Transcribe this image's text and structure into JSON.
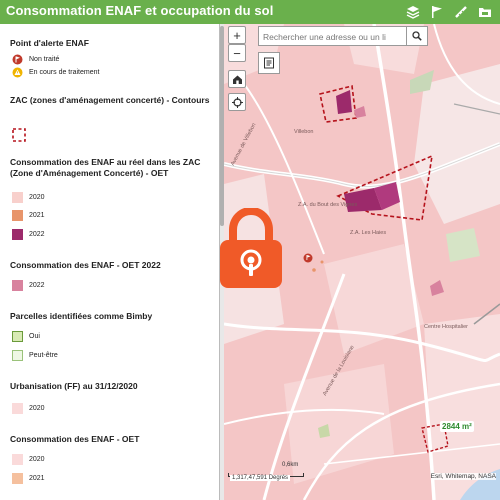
{
  "header": {
    "title": "Consommation ENAF et occupation du sol",
    "background": "#6ab04c",
    "tools": [
      "layers-icon",
      "flag-icon",
      "ruler-icon",
      "folder-icon"
    ]
  },
  "legend": {
    "sections": [
      {
        "title": "Point d'alerte ENAF",
        "items": [
          {
            "label": "Non traité",
            "symbol": "red-flag-marker",
            "color": "#c0392b"
          },
          {
            "label": "En cours de traitement",
            "symbol": "warning-marker",
            "color": "#f0b400"
          }
        ]
      },
      {
        "title": "ZAC (zones d'aménagement concerté) - Contours",
        "items": [
          {
            "label": "",
            "symbol": "dashed-outline",
            "color": "#b5121b"
          }
        ]
      },
      {
        "title": "Consommation des ENAF au réel dans les ZAC (Zone d'Aménagement Concerté) - OET",
        "items": [
          {
            "label": "2020",
            "color": "#f8d0cc"
          },
          {
            "label": "2021",
            "color": "#e8956b"
          },
          {
            "label": "2022",
            "color": "#9c2a6b"
          }
        ]
      },
      {
        "title": "Consommation des ENAF - OET 2022",
        "items": [
          {
            "label": "2022",
            "color": "#d8829e"
          }
        ]
      },
      {
        "title": "Parcelles identifiées comme Bimby",
        "items": [
          {
            "label": "Oui",
            "color": "#d8eab4",
            "border": "#6a9a3a"
          },
          {
            "label": "Peut-être",
            "color": "#eef7e4",
            "border": "#9ac27a"
          }
        ]
      },
      {
        "title": "Urbanisation (FF) au 31/12/2020",
        "items": [
          {
            "label": "2020",
            "color": "#fadada"
          }
        ]
      },
      {
        "title": "Consommation des ENAF - OET",
        "items": [
          {
            "label": "2020",
            "color": "#fadada"
          },
          {
            "label": "2021",
            "color": "#f5c09e"
          }
        ]
      }
    ]
  },
  "map": {
    "zoom_in": "+",
    "zoom_out": "−",
    "search_placeholder": "Rechercher une adresse ou un li",
    "area_label": "2844 m²",
    "scale_label": "0,6km",
    "coordinates": "1,317,47,591 Degrés",
    "attribution": "Esri, Whitemap, NASA",
    "place_labels": [
      "Villebon",
      "Z.A. du Bout des Vignes",
      "Z.A. Les Haies",
      "Centre Hospitalier",
      "Avenue de Villebon",
      "Avenue de la Louisiane"
    ],
    "lock_color": "#f05a28"
  }
}
